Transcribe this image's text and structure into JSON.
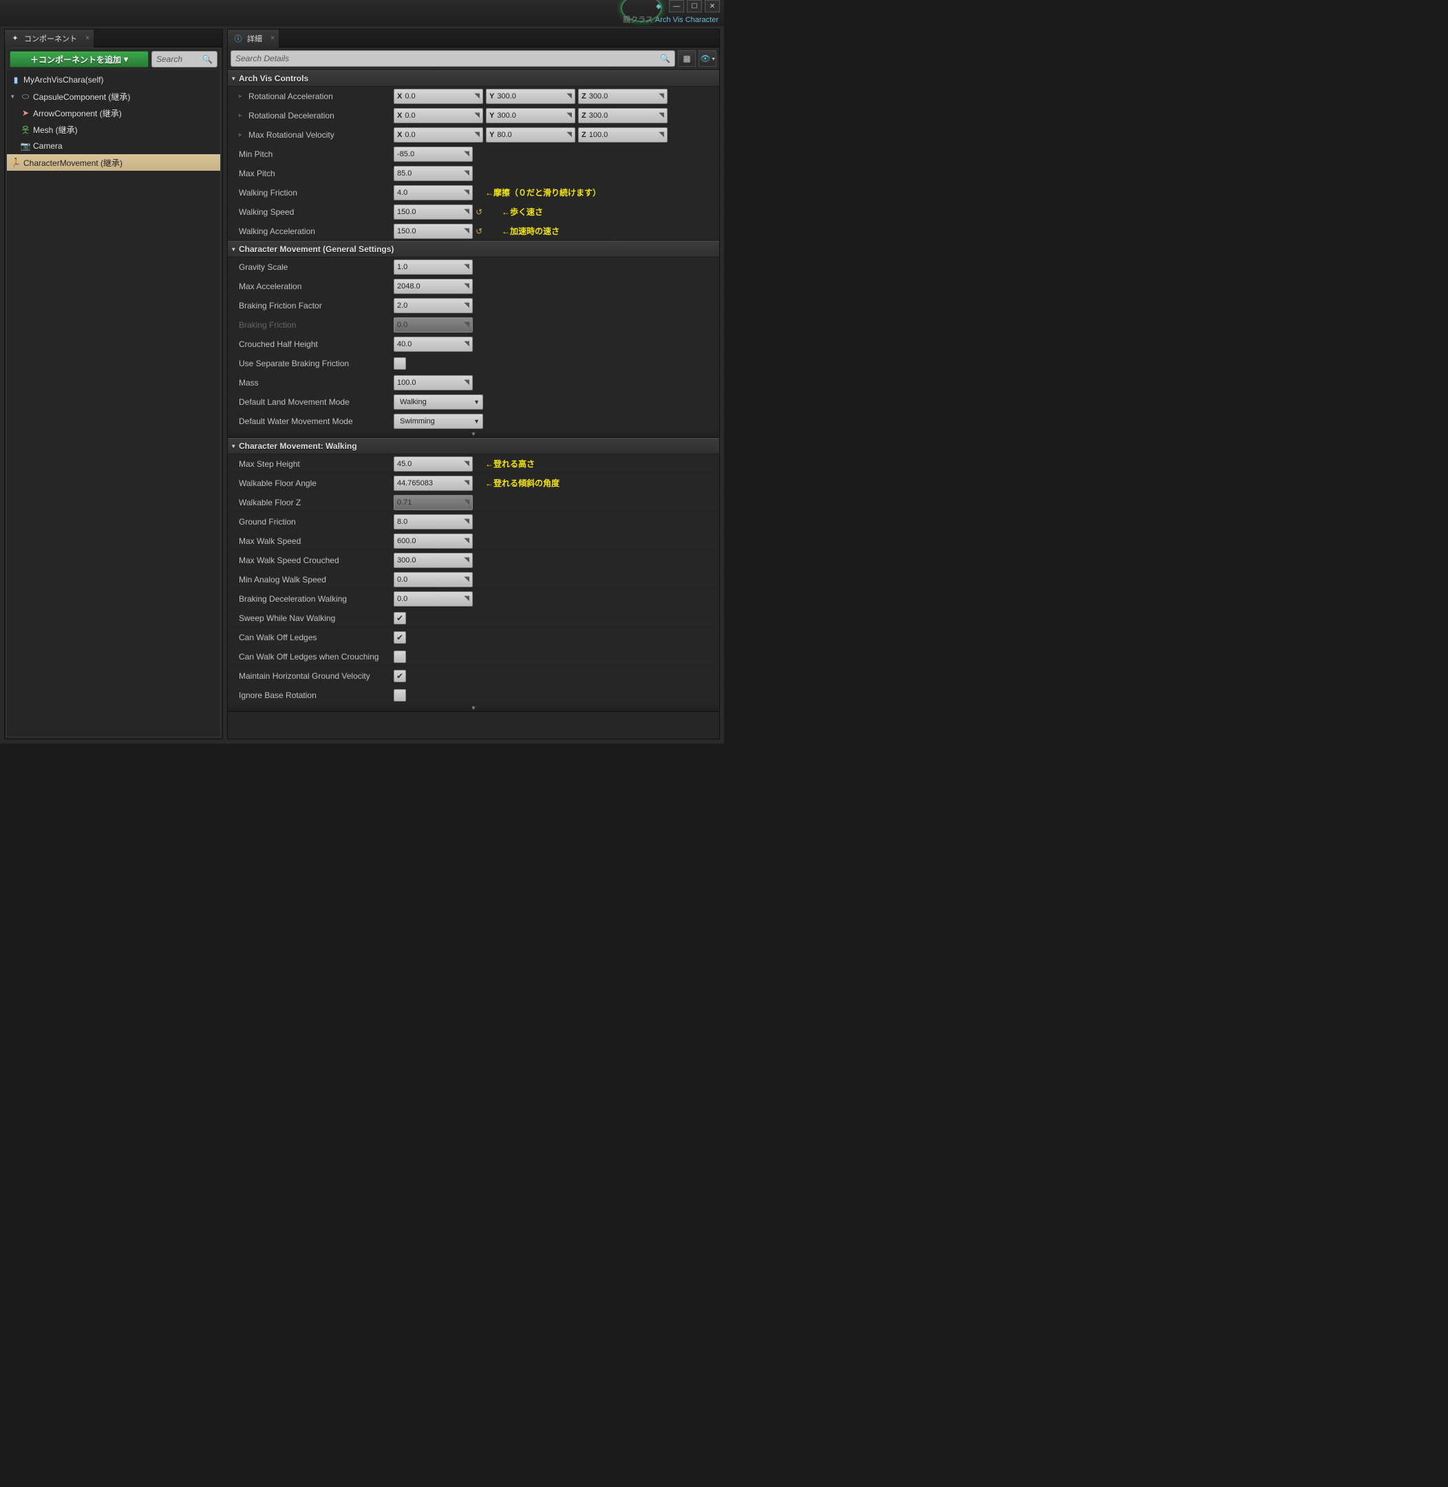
{
  "titlebar": {
    "parentLabel": "親クラス",
    "parentLink": "Arch Vis Character"
  },
  "leftPanel": {
    "tabTitle": "コンポーネント",
    "addButton": "＋コンポーネントを追加",
    "searchPlaceholder": "Search",
    "tree": {
      "root": "MyArchVisChara(self)",
      "capsule": "CapsuleComponent (継承)",
      "arrow": "ArrowComponent (継承)",
      "mesh": "Mesh (継承)",
      "camera": "Camera",
      "charMove": "CharacterMovement (継承)"
    }
  },
  "rightPanel": {
    "tabTitle": "詳細",
    "searchPlaceholder": "Search Details"
  },
  "cats": {
    "archVis": "Arch Vis Controls",
    "general": "Character Movement (General Settings)",
    "walking": "Character Movement: Walking"
  },
  "props": {
    "rotAccel": {
      "label": "Rotational Acceleration",
      "x": "0.0",
      "y": "300.0",
      "z": "300.0"
    },
    "rotDecel": {
      "label": "Rotational Deceleration",
      "x": "0.0",
      "y": "300.0",
      "z": "300.0"
    },
    "maxRotVel": {
      "label": "Max Rotational Velocity",
      "x": "0.0",
      "y": "80.0",
      "z": "100.0"
    },
    "minPitch": {
      "label": "Min Pitch",
      "val": "-85.0"
    },
    "maxPitch": {
      "label": "Max Pitch",
      "val": "85.0"
    },
    "walkFric": {
      "label": "Walking Friction",
      "val": "4.0",
      "note": "←摩擦（０だと滑り続けます）"
    },
    "walkSpeed": {
      "label": "Walking Speed",
      "val": "150.0",
      "note": "←歩く速さ"
    },
    "walkAccel": {
      "label": "Walking Acceleration",
      "val": "150.0",
      "note": "←加速時の速さ"
    },
    "gravityScale": {
      "label": "Gravity Scale",
      "val": "1.0"
    },
    "maxAccel": {
      "label": "Max Acceleration",
      "val": "2048.0"
    },
    "brakingFF": {
      "label": "Braking Friction Factor",
      "val": "2.0"
    },
    "brakingF": {
      "label": "Braking Friction",
      "val": "0.0"
    },
    "crouchHH": {
      "label": "Crouched Half Height",
      "val": "40.0"
    },
    "useSepBF": {
      "label": "Use Separate Braking Friction"
    },
    "mass": {
      "label": "Mass",
      "val": "100.0"
    },
    "landMode": {
      "label": "Default Land Movement Mode",
      "val": "Walking"
    },
    "waterMode": {
      "label": "Default Water Movement Mode",
      "val": "Swimming"
    },
    "maxStepH": {
      "label": "Max Step Height",
      "val": "45.0",
      "note": "←登れる高さ"
    },
    "walkFloorA": {
      "label": "Walkable Floor Angle",
      "val": "44.765083",
      "note": "←登れる傾斜の角度"
    },
    "walkFloorZ": {
      "label": "Walkable Floor Z",
      "val": "0.71"
    },
    "groundFric": {
      "label": "Ground Friction",
      "val": "8.0"
    },
    "maxWalkSp": {
      "label": "Max Walk Speed",
      "val": "600.0"
    },
    "maxWalkSpC": {
      "label": "Max Walk Speed Crouched",
      "val": "300.0"
    },
    "minAnalog": {
      "label": "Min Analog Walk Speed",
      "val": "0.0"
    },
    "brakeDecelW": {
      "label": "Braking Deceleration Walking",
      "val": "0.0"
    },
    "sweepNav": {
      "label": "Sweep While Nav Walking"
    },
    "canWalkOff": {
      "label": "Can Walk Off Ledges"
    },
    "canWalkOffC": {
      "label": "Can Walk Off Ledges when Crouching"
    },
    "maintainHGV": {
      "label": "Maintain Horizontal Ground Velocity"
    },
    "ignoreBaseRot": {
      "label": "Ignore Base Rotation"
    }
  }
}
